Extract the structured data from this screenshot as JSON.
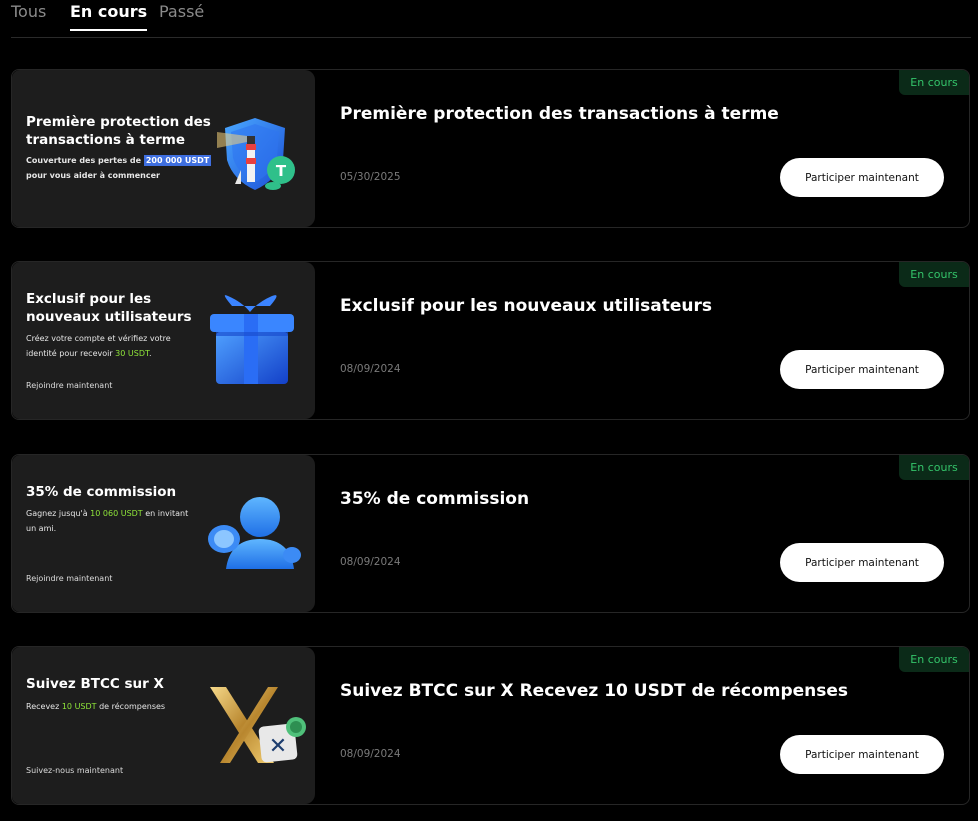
{
  "tabs": [
    "Tous",
    "En cours",
    "Passé"
  ],
  "cards": [
    {
      "banner_title": "Première protection des transactions à terme",
      "banner_desc_pre": "Couverture des pertes de ",
      "banner_desc_highlight": "200 000 USDT",
      "banner_desc_post": "pour vous aider à commencer",
      "title": "Première protection des transactions à terme",
      "date": "05/30/2025",
      "button": "Participer maintenant",
      "status": "En cours",
      "icon": "shield-lighthouse-icon"
    },
    {
      "banner_title": "Exclusif pour les nouveaux utilisateurs",
      "banner_desc_pre": "Créez votre compte et vérifiez votre identité pour recevoir ",
      "banner_desc_highlight": "30 USDT",
      "banner_desc_post": ".",
      "banner_link": "Rejoindre maintenant",
      "title": "Exclusif pour les nouveaux utilisateurs",
      "date": "08/09/2024",
      "button": "Participer maintenant",
      "status": "En cours",
      "icon": "gift-box-icon"
    },
    {
      "banner_title": "35% de commission",
      "banner_desc_pre": "Gagnez jusqu'à ",
      "banner_desc_highlight": "10 060 USDT",
      "banner_desc_post": " en invitant un ami.",
      "banner_link": "Rejoindre maintenant",
      "title": "35% de commission",
      "date": "08/09/2024",
      "button": "Participer maintenant",
      "status": "En cours",
      "icon": "user-coins-icon"
    },
    {
      "banner_title": "Suivez BTCC sur X",
      "banner_desc_pre": "Recevez ",
      "banner_desc_highlight": "10 USDT",
      "banner_desc_post": " de récompenses",
      "banner_link": "Suivez-nous maintenant",
      "title": "Suivez BTCC sur X  Recevez 10 USDT de récompenses",
      "date": "08/09/2024",
      "button": "Participer maintenant",
      "status": "En cours",
      "icon": "x-logo-icon"
    }
  ],
  "colors": {
    "accent_green": "#34c46a",
    "badge_bg": "#0b2a18",
    "highlight_blue": "#3f6fe0",
    "highlight_green": "#8fe53a"
  }
}
